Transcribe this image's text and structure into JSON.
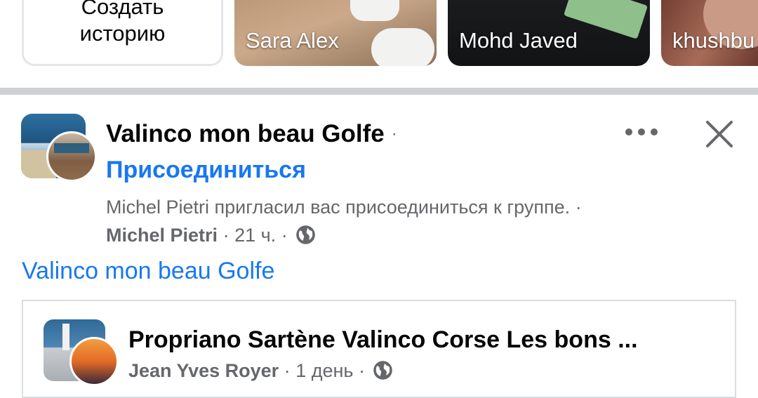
{
  "stories": {
    "create_label": "Создать\nисторию",
    "items": [
      {
        "name": "Sara Alex"
      },
      {
        "name": "Mohd Javed"
      },
      {
        "name": "khushbu"
      }
    ]
  },
  "post": {
    "group_title": "Valinco mon beau Golfe",
    "title_separator": "·",
    "join_label": "Присоединиться",
    "invite_text": "Michel Pietri пригласил вас присоединиться к группе.",
    "meta_separator": "·",
    "inviter": "Michel Pietri",
    "time": "21 ч.",
    "group_link": "Valinco mon beau Golfe",
    "icons": {
      "more": "more-dots-icon",
      "close": "close-icon",
      "audience": "globe-icon"
    }
  },
  "embed": {
    "title": "Propriano Sartène Valinco Corse Les bons ...",
    "author": "Jean Yves Royer",
    "time": "1 день",
    "separator": "·"
  },
  "colors": {
    "link": "#1877f2",
    "secondary_text": "#65676b",
    "divider": "#ced0d4"
  }
}
